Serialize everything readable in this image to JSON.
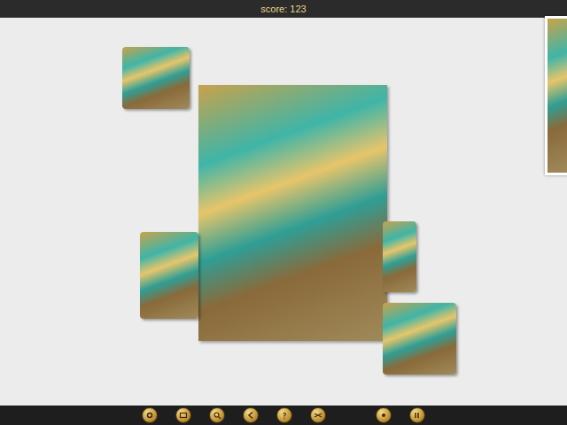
{
  "top_bar": {
    "score": "score: 123"
  }
}
